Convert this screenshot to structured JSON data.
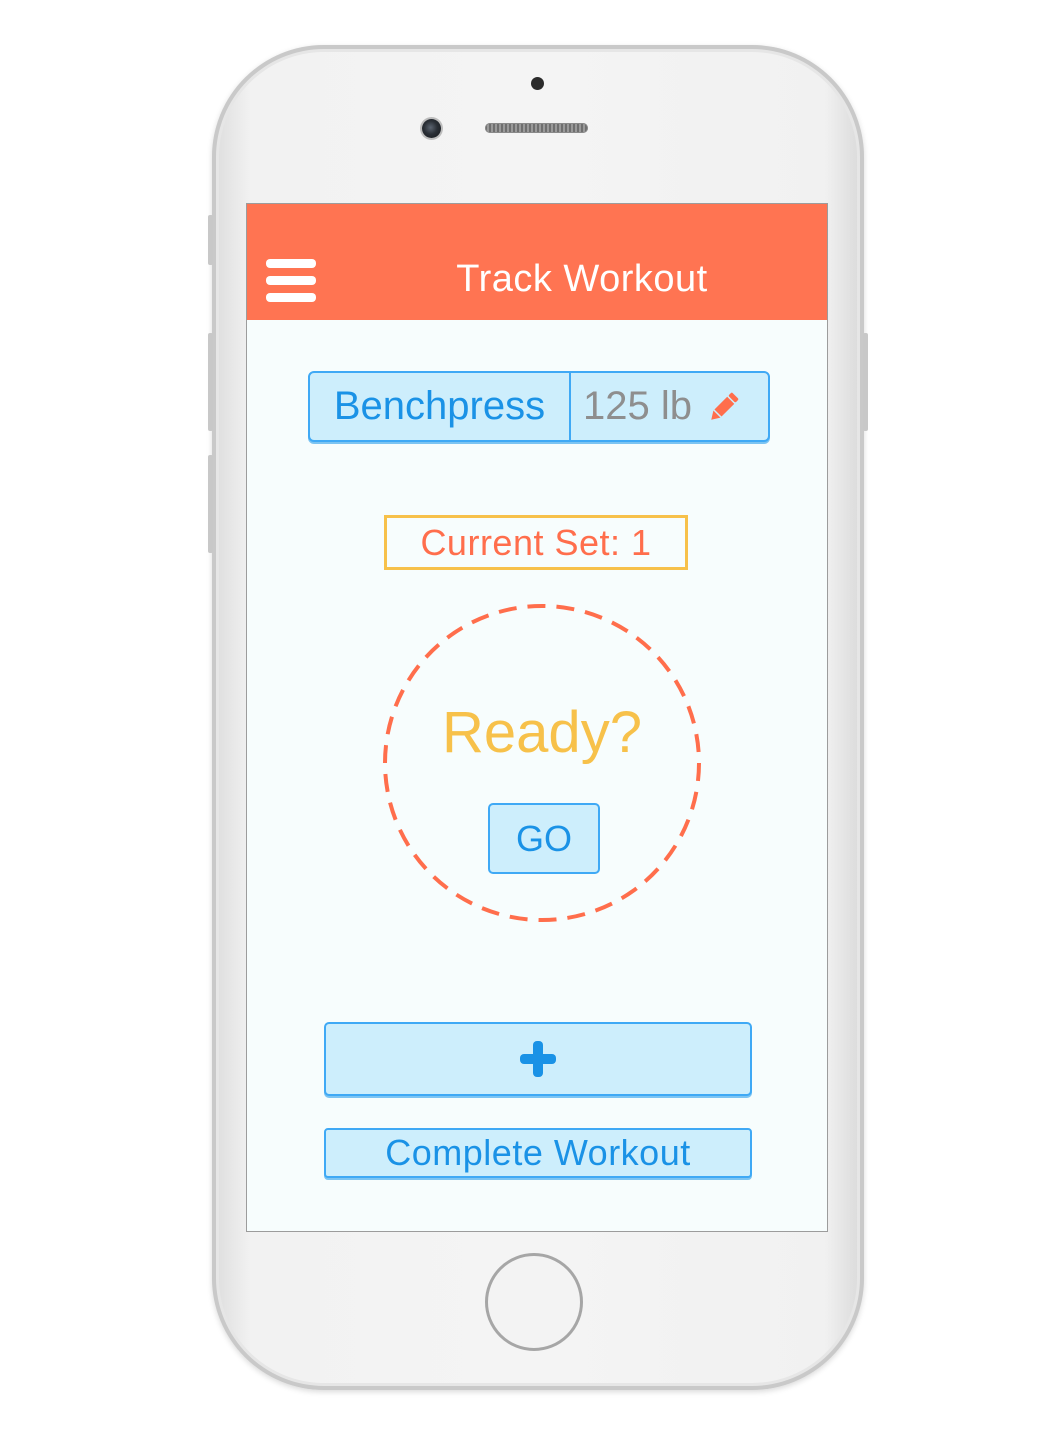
{
  "colors": {
    "header": "#ff7452",
    "accent_blue": "#1a92e6",
    "button_fill": "#cdeefc",
    "button_border": "#3fa9f5",
    "set_border": "#f7c14a",
    "set_text": "#ff6e4c",
    "ready_text": "#f7c14a",
    "timer_ring": "#ff6e4c",
    "weight_text": "#8e8e8e",
    "pencil": "#ff6e4c"
  },
  "header": {
    "title": "Track Workout",
    "menu_icon": "hamburger-menu-icon"
  },
  "exercise": {
    "name": "Benchpress",
    "weight": "125 lb",
    "edit_icon": "pencil-icon"
  },
  "set": {
    "label": "Current Set: 1"
  },
  "timer": {
    "ready_text": "Ready?",
    "go_label": "GO"
  },
  "actions": {
    "add_icon": "plus-icon",
    "complete_label": "Complete Workout"
  }
}
